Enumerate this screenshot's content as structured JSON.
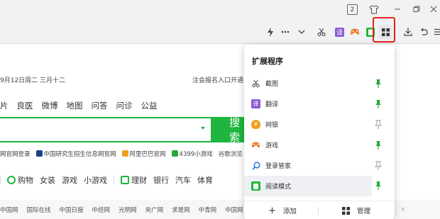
{
  "titlebar": {
    "tab_count": "2"
  },
  "page": {
    "date_line": "9月12日周二  三月十二",
    "login_link": "注会报名入口开通",
    "nav_tabs": [
      "片",
      "良医",
      "微博",
      "地图",
      "问答",
      "问诊",
      "公益"
    ],
    "search_button": "搜 索",
    "sites": [
      {
        "label": "网官网登录",
        "icon_color": ""
      },
      {
        "label": "中国研究生招生信息网官网",
        "icon_color": "#1d3f8a"
      },
      {
        "label": "阿里巴巴官网",
        "icon_color": "#f0a020"
      },
      {
        "label": "4399小游戏",
        "icon_color": "#2aa83c"
      },
      {
        "label": "谷歌浏览",
        "icon_color": ""
      }
    ],
    "categories": [
      "购物",
      "女装",
      "游戏",
      "小游戏",
      "理财",
      "银行",
      "汽车",
      "体育"
    ],
    "bottom_links": [
      "中国网",
      "国际在线",
      "中国日报",
      "中经网",
      "光明网",
      "央广网",
      "求是网",
      "中青网",
      "中国网"
    ]
  },
  "popup": {
    "title": "扩展程序",
    "items": [
      {
        "label": "截图",
        "icon": "scissors-icon",
        "pinned": true
      },
      {
        "label": "翻译",
        "icon": "translate-icon",
        "pinned": true
      },
      {
        "label": "网银",
        "icon": "bank-icon",
        "pinned": false
      },
      {
        "label": "游戏",
        "icon": "game-icon",
        "pinned": true
      },
      {
        "label": "登录管家",
        "icon": "login-search-icon",
        "pinned": false
      },
      {
        "label": "阅读模式",
        "icon": "reading-mode-icon",
        "pinned": true
      }
    ],
    "add_label": "添加",
    "manage_label": "管理"
  },
  "colors": {
    "accent": "#1fb53f",
    "highlight": "#e0251b",
    "pin_active": "#2aa83c",
    "pin_inactive": "#999999"
  }
}
